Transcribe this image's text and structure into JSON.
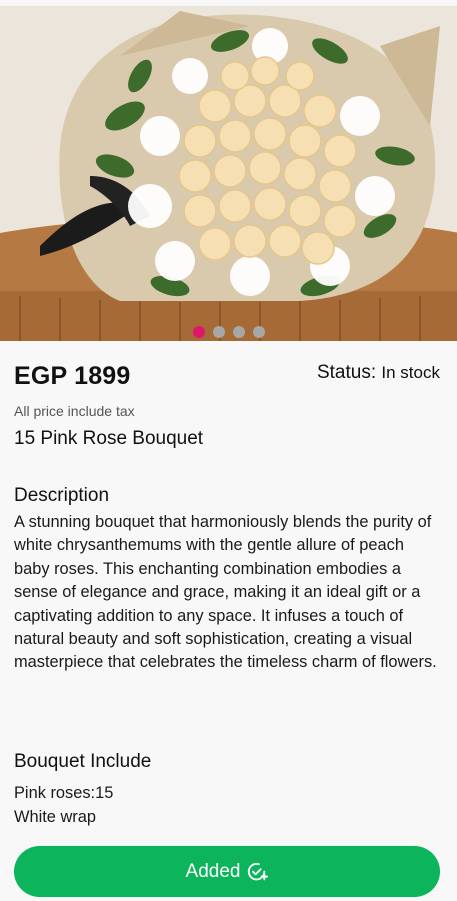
{
  "product": {
    "price": "EGP 1899",
    "status_label": "Status:",
    "status_value": "In stock",
    "tax_note": "All price include tax",
    "name": "15 Pink Rose Bouquet"
  },
  "description": {
    "title": "Description",
    "body": "A stunning bouquet that harmoniously blends the purity of white chrysanthemums with the gentle allure of peach baby roses. This enchanting combination embodies a sense of elegance and grace, making it an ideal gift or a captivating addition to any space. It infuses a touch of natural beauty and soft sophistication, creating a visual masterpiece that celebrates the timeless charm of flowers."
  },
  "includes": {
    "title": "Bouquet Include",
    "items": [
      "Pink roses:15",
      "White wrap"
    ]
  },
  "carousel": {
    "count": 4,
    "active": 0
  },
  "action": {
    "label": "Added",
    "icon": "check-circle-plus-icon"
  },
  "colors": {
    "accent": "#0cb45b",
    "dot_active": "#e0156b",
    "dot_inactive": "#a7a7a7"
  }
}
